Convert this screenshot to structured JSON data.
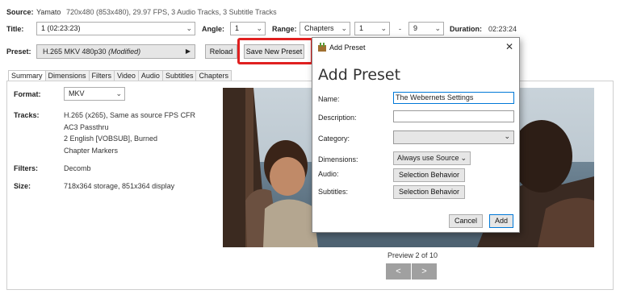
{
  "source": {
    "label": "Source:",
    "name": "Yamato",
    "details": "720x480 (853x480), 29.97 FPS, 3 Audio Tracks, 3 Subtitle Tracks"
  },
  "title_row": {
    "title_label": "Title:",
    "title_value": "1 (02:23:23)",
    "angle_label": "Angle:",
    "angle_value": "1",
    "range_label": "Range:",
    "range_value": "Chapters",
    "range_start": "1",
    "range_sep": "-",
    "range_end": "9",
    "duration_label": "Duration:",
    "duration_value": "02:23:24"
  },
  "preset_row": {
    "label": "Preset:",
    "value": "H.265 MKV 480p30",
    "modified": "(Modified)",
    "reload_label": "Reload",
    "save_new_label": "Save New Preset"
  },
  "tabs": [
    "Summary",
    "Dimensions",
    "Filters",
    "Video",
    "Audio",
    "Subtitles",
    "Chapters"
  ],
  "summary": {
    "format_label": "Format:",
    "format_value": "MKV",
    "tracks_label": "Tracks:",
    "tracks": [
      "H.265 (x265), Same as source FPS CFR",
      "AC3 Passthru",
      "2 English [VOBSUB], Burned",
      "Chapter Markers"
    ],
    "filters_label": "Filters:",
    "filters_value": "Decomb",
    "size_label": "Size:",
    "size_value": "718x364 storage, 851x364 display"
  },
  "preview": {
    "caption": "Preview 2 of 10",
    "prev": "<",
    "next": ">"
  },
  "dialog": {
    "window_title": "Add Preset",
    "close": "✕",
    "heading": "Add Preset",
    "name_label": "Name:",
    "name_value": "The Webernets Settings",
    "description_label": "Description:",
    "description_value": "",
    "category_label": "Category:",
    "category_value": "",
    "dimensions_label": "Dimensions:",
    "dimensions_value": "Always use Source",
    "audio_label": "Audio:",
    "audio_button": "Selection Behavior",
    "subtitles_label": "Subtitles:",
    "subtitles_button": "Selection Behavior",
    "cancel": "Cancel",
    "add": "Add"
  },
  "colors": {
    "highlight": "#e02020",
    "accent": "#0078d7"
  }
}
